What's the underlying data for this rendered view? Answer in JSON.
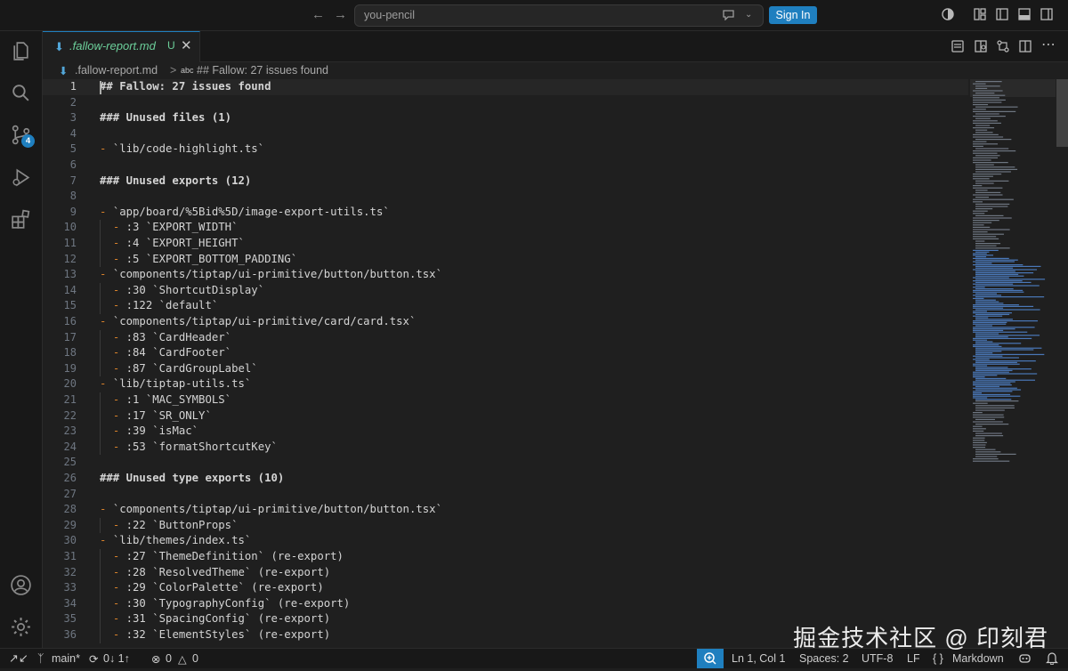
{
  "titlebar": {
    "search_text": "you-pencil",
    "sign_in": "Sign In"
  },
  "activity_bar": {
    "items": [
      "explorer-icon",
      "search-icon",
      "source-control-icon",
      "run-debug-icon",
      "extensions-icon"
    ],
    "scm_badge": "4",
    "bottom": [
      "account-icon",
      "settings-gear-icon"
    ]
  },
  "tab": {
    "filename": ".fallow-report.md",
    "status": "U",
    "label_color": "#6ccf9a"
  },
  "breadcrumb": {
    "file": ".fallow-report.md",
    "separator": ">",
    "symbol_icon": "abc",
    "symbol": "## Fallow: 27 issues found"
  },
  "editor": {
    "lines": [
      {
        "n": "1",
        "code": "## Fallow: 27 issues found",
        "kind": "h"
      },
      {
        "n": "2",
        "code": "",
        "kind": "plain"
      },
      {
        "n": "3",
        "code": "### Unused files (1)",
        "kind": "h"
      },
      {
        "n": "4",
        "code": "",
        "kind": "plain"
      },
      {
        "n": "5",
        "code": "- `lib/code-highlight.ts`",
        "kind": "item"
      },
      {
        "n": "6",
        "code": "",
        "kind": "plain"
      },
      {
        "n": "7",
        "code": "### Unused exports (12)",
        "kind": "h"
      },
      {
        "n": "8",
        "code": "",
        "kind": "plain"
      },
      {
        "n": "9",
        "code": "- `app/board/%5Bid%5D/image-export-utils.ts`",
        "kind": "item"
      },
      {
        "n": "10",
        "code": "  - :3 `EXPORT_WIDTH`",
        "kind": "sub"
      },
      {
        "n": "11",
        "code": "  - :4 `EXPORT_HEIGHT`",
        "kind": "sub"
      },
      {
        "n": "12",
        "code": "  - :5 `EXPORT_BOTTOM_PADDING`",
        "kind": "sub"
      },
      {
        "n": "13",
        "code": "- `components/tiptap/ui-primitive/button/button.tsx`",
        "kind": "item"
      },
      {
        "n": "14",
        "code": "  - :30 `ShortcutDisplay`",
        "kind": "sub"
      },
      {
        "n": "15",
        "code": "  - :122 `default`",
        "kind": "sub"
      },
      {
        "n": "16",
        "code": "- `components/tiptap/ui-primitive/card/card.tsx`",
        "kind": "item"
      },
      {
        "n": "17",
        "code": "  - :83 `CardHeader`",
        "kind": "sub"
      },
      {
        "n": "18",
        "code": "  - :84 `CardFooter`",
        "kind": "sub"
      },
      {
        "n": "19",
        "code": "  - :87 `CardGroupLabel`",
        "kind": "sub"
      },
      {
        "n": "20",
        "code": "- `lib/tiptap-utils.ts`",
        "kind": "item"
      },
      {
        "n": "21",
        "code": "  - :1 `MAC_SYMBOLS`",
        "kind": "sub"
      },
      {
        "n": "22",
        "code": "  - :17 `SR_ONLY`",
        "kind": "sub"
      },
      {
        "n": "23",
        "code": "  - :39 `isMac`",
        "kind": "sub"
      },
      {
        "n": "24",
        "code": "  - :53 `formatShortcutKey`",
        "kind": "sub"
      },
      {
        "n": "25",
        "code": "",
        "kind": "plain"
      },
      {
        "n": "26",
        "code": "### Unused type exports (10)",
        "kind": "h"
      },
      {
        "n": "27",
        "code": "",
        "kind": "plain"
      },
      {
        "n": "28",
        "code": "- `components/tiptap/ui-primitive/button/button.tsx`",
        "kind": "item"
      },
      {
        "n": "29",
        "code": "  - :22 `ButtonProps`",
        "kind": "sub"
      },
      {
        "n": "30",
        "code": "- `lib/themes/index.ts`",
        "kind": "item"
      },
      {
        "n": "31",
        "code": "  - :27 `ThemeDefinition` (re-export)",
        "kind": "sub"
      },
      {
        "n": "32",
        "code": "  - :28 `ResolvedTheme` (re-export)",
        "kind": "sub"
      },
      {
        "n": "33",
        "code": "  - :29 `ColorPalette` (re-export)",
        "kind": "sub"
      },
      {
        "n": "34",
        "code": "  - :30 `TypographyConfig` (re-export)",
        "kind": "sub"
      },
      {
        "n": "35",
        "code": "  - :31 `SpacingConfig` (re-export)",
        "kind": "sub"
      },
      {
        "n": "36",
        "code": "  - :32 `ElementStyles` (re-export)",
        "kind": "sub"
      }
    ],
    "current_line": "1",
    "colors": {
      "heading": "#5aa3e6",
      "bullet": "#d9822b",
      "text": "#d4d4d4"
    }
  },
  "statusbar": {
    "branch": "main*",
    "sync": "0↓ 1↑",
    "errors": "0",
    "warnings": "0",
    "position": "Ln 1, Col 1",
    "spaces": "Spaces: 2",
    "encoding": "UTF-8",
    "eol": "LF",
    "language_braces": "{ }",
    "language": "Markdown"
  },
  "watermark": "掘金技术社区 @ 印刻君"
}
